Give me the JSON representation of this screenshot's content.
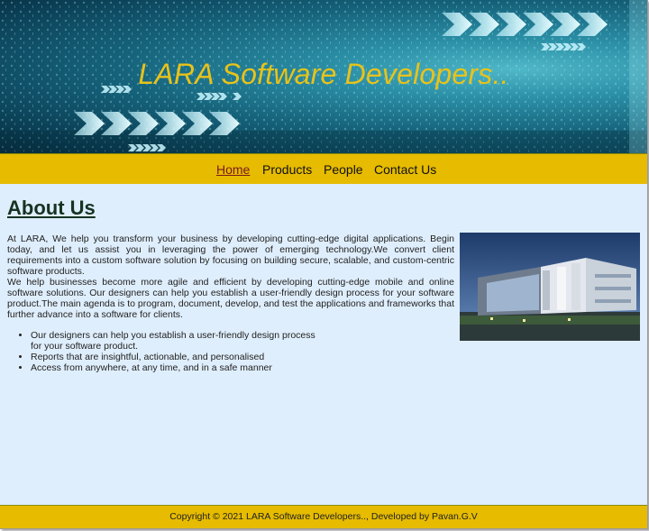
{
  "banner": {
    "title": "LARA Software Developers.."
  },
  "nav": {
    "items": [
      {
        "label": "Home"
      },
      {
        "label": "Products"
      },
      {
        "label": "People"
      },
      {
        "label": "Contact Us"
      }
    ],
    "active": "Home"
  },
  "about": {
    "title": "About Us",
    "paragraphs": [
      "At LARA, We help you transform your business by developing cutting-edge digital applications. Begin today, and let us assist you in leveraging the power of emerging technology.We convert client requirements into a custom software solution by focusing on building secure, scalable, and custom-centric software products.",
      "We help businesses become more agile and efficient by developing cutting-edge mobile and online software solutions. Our designers can help you establish a user-friendly design process for your software product.The main agenda is to program, document, develop, and test the applications and frameworks that further advance into a software for clients."
    ],
    "bullets": [
      "Our designers can help you establish a user-friendly design process for your software product.",
      "Reports that are insightful, actionable, and personalised",
      "Access from anywhere, at any time, and in a safe manner"
    ]
  },
  "footer": {
    "text": "Copyright © 2021 LARA Software Developers.., Developed by Pavan.G.V"
  },
  "colors": {
    "accent": "#e6bb00",
    "title": "#e8c21a",
    "background": "#dfeefc",
    "heading": "#163322"
  }
}
